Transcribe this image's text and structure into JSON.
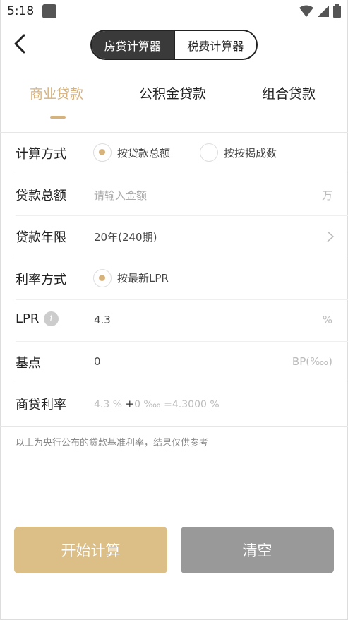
{
  "status": {
    "time": "5:18"
  },
  "nav": {
    "segments": [
      "房贷计算器",
      "税费计算器"
    ]
  },
  "tabs": [
    "商业贷款",
    "公积金贷款",
    "组合贷款"
  ],
  "form": {
    "calc_method": {
      "label": "计算方式",
      "option1": "按贷款总额",
      "option2": "按按揭成数"
    },
    "loan_amount": {
      "label": "贷款总额",
      "placeholder": "请输入金额",
      "unit": "万"
    },
    "loan_term": {
      "label": "贷款年限",
      "value": "20年(240期)"
    },
    "rate_method": {
      "label": "利率方式",
      "option": "按最新LPR"
    },
    "lpr": {
      "label": "LPR",
      "info_glyph": "i",
      "value": "4.3",
      "unit": "%"
    },
    "basis_points": {
      "label": "基点",
      "value": "0",
      "unit": "BP(‱)"
    },
    "commercial_rate": {
      "label": "商贷利率",
      "part1": "4.3 %",
      "plus": "+",
      "part2": "0 ‱",
      "eq": "=4.3000 %"
    }
  },
  "note": "以上为央行公布的贷款基准利率，结果仅供参考",
  "buttons": {
    "start": "开始计算",
    "clear": "清空"
  },
  "colors": {
    "accent": "#d6b27d",
    "start_button": "#dcbf86",
    "clear_button": "#999999",
    "segment_active": "#3a3a3a"
  }
}
